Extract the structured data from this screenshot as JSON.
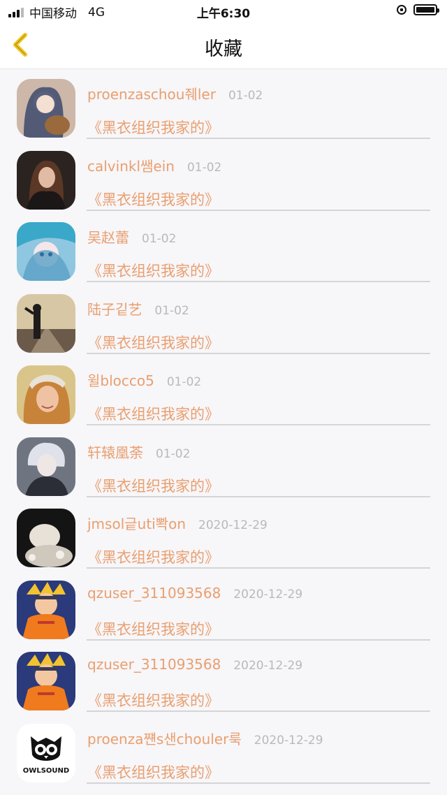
{
  "status_bar": {
    "carrier": "中国移动",
    "network": "4G",
    "time": "上午6:30"
  },
  "nav": {
    "title": "收藏",
    "back_icon": "chevron-left-icon",
    "accent": "#f0c419"
  },
  "colors": {
    "accent_text": "#e99f6e",
    "date_text": "#b9b9b9",
    "divider": "#d5d5d5"
  },
  "items": [
    {
      "name": "proenzaschou줴ler",
      "date": "01-02",
      "title": "《黑衣组织我家的》"
    },
    {
      "name": "calvinkl쌤ein",
      "date": "01-02",
      "title": "《黑衣组织我家的》"
    },
    {
      "name": "吴赵蕾",
      "date": "01-02",
      "title": "《黑衣组织我家的》"
    },
    {
      "name": "陆子깉艺",
      "date": "01-02",
      "title": "《黑衣组织我家的》"
    },
    {
      "name": "윌blocco5",
      "date": "01-02",
      "title": "《黑衣组织我家的》"
    },
    {
      "name": "轩辕凰荼",
      "date": "01-02",
      "title": "《黑衣组织我家的》"
    },
    {
      "name": "jmsol긑uti뽝on",
      "date": "2020-12-29",
      "title": "《黑衣组织我家的》"
    },
    {
      "name": "qzuser_311093568",
      "date": "2020-12-29",
      "title": "《黑衣组织我家的》"
    },
    {
      "name": "qzuser_311093568",
      "date": "2020-12-29",
      "title": "《黑衣组织我家的》"
    },
    {
      "name": "proenza쨴s샌chouler룩",
      "date": "2020-12-29",
      "title": "《黑衣组织我家的》",
      "avatar_logo_text": "OWLSOUND"
    }
  ]
}
